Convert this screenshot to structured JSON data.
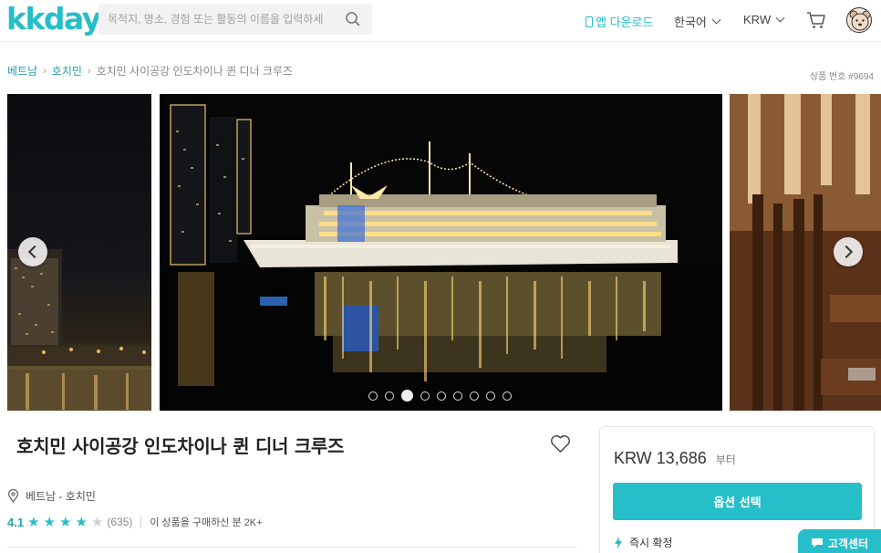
{
  "header": {
    "logo": "kkday",
    "search_placeholder": "목적지, 명소, 경험 또는 활동의 이름을 입력하세",
    "app_download": "앱 다운로드",
    "language": "한국어",
    "currency": "KRW"
  },
  "breadcrumb": {
    "items": [
      "베트남",
      "호치민"
    ],
    "current": "호치민 사이공강 인도차이나 퀸 디너 크루즈"
  },
  "product_no": "상품 번호 #9694",
  "gallery": {
    "total_slides": 9,
    "active_slide": 3
  },
  "product": {
    "title": "호치민 사이공강 인도차이나 퀸 디너 크루즈",
    "location": "베트남 - 호치민",
    "rating": "4.1",
    "review_count": "(635)",
    "purchased": "이 상품을 구매하신 분 2K+",
    "stars": 4
  },
  "booking": {
    "price": "KRW 13,686",
    "price_suffix": "부터",
    "select_option": "옵션 선택",
    "instant_confirm": "즉시 확정"
  },
  "support": "고객센터",
  "colors": {
    "brand": "#26bec9"
  }
}
